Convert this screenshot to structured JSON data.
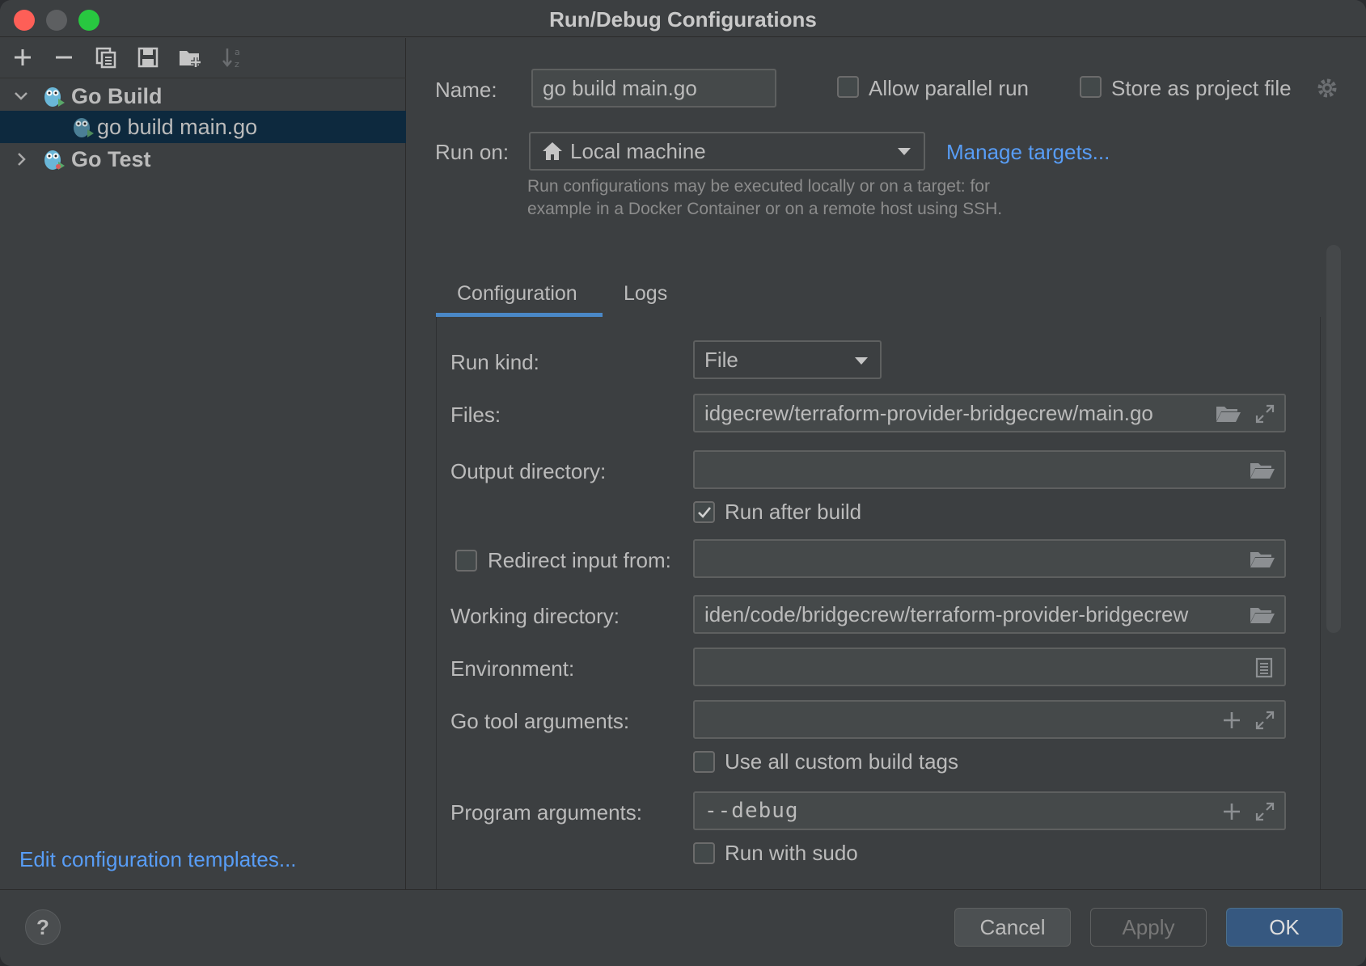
{
  "window": {
    "title": "Run/Debug Configurations"
  },
  "toolbar": {
    "icons": [
      "add-icon",
      "remove-icon",
      "copy-icon",
      "save-icon",
      "new-folder-icon",
      "sort-alpha-icon"
    ]
  },
  "tree": {
    "items": [
      {
        "label": "Go Build",
        "expanded": true,
        "bold": true
      },
      {
        "label": "go build main.go",
        "selected": true
      },
      {
        "label": "Go Test",
        "expanded": false,
        "bold": true
      }
    ]
  },
  "left_footer": {
    "edit_templates": "Edit configuration templates..."
  },
  "header": {
    "name_label": "Name:",
    "name_value": "go build main.go",
    "allow_parallel_label": "Allow parallel run",
    "allow_parallel_checked": false,
    "store_project_label": "Store as project file",
    "store_project_checked": false,
    "run_on_label": "Run on:",
    "run_on_value": "Local machine",
    "manage_targets": "Manage targets...",
    "hint_line1": "Run configurations may be executed locally or on a target: for",
    "hint_line2": "example in a Docker Container or on a remote host using SSH."
  },
  "tabs": [
    {
      "label": "Configuration",
      "active": true
    },
    {
      "label": "Logs",
      "active": false
    }
  ],
  "config": {
    "run_kind_label": "Run kind:",
    "run_kind_value": "File",
    "files_label": "Files:",
    "files_value": "idgecrew/terraform-provider-bridgecrew/main.go",
    "output_dir_label": "Output directory:",
    "output_dir_value": "",
    "run_after_build_label": "Run after build",
    "run_after_build_checked": true,
    "redirect_input_label": "Redirect input from:",
    "redirect_input_checked": false,
    "redirect_input_value": "",
    "working_dir_label": "Working directory:",
    "working_dir_value": "iden/code/bridgecrew/terraform-provider-bridgecrew",
    "environment_label": "Environment:",
    "environment_value": "",
    "go_tool_args_label": "Go tool arguments:",
    "go_tool_args_value": "",
    "use_custom_tags_label": "Use all custom build tags",
    "use_custom_tags_checked": false,
    "program_args_label": "Program arguments:",
    "program_args_value": "--debug",
    "run_with_sudo_label": "Run with sudo",
    "run_with_sudo_checked": false
  },
  "buttons": {
    "help": "?",
    "cancel": "Cancel",
    "apply": "Apply",
    "ok": "OK"
  },
  "colors": {
    "background": "#3c3f41",
    "accent_link": "#589df6",
    "selection": "#0d293e",
    "ok_button": "#365880",
    "tab_underline": "#4a88c7"
  }
}
